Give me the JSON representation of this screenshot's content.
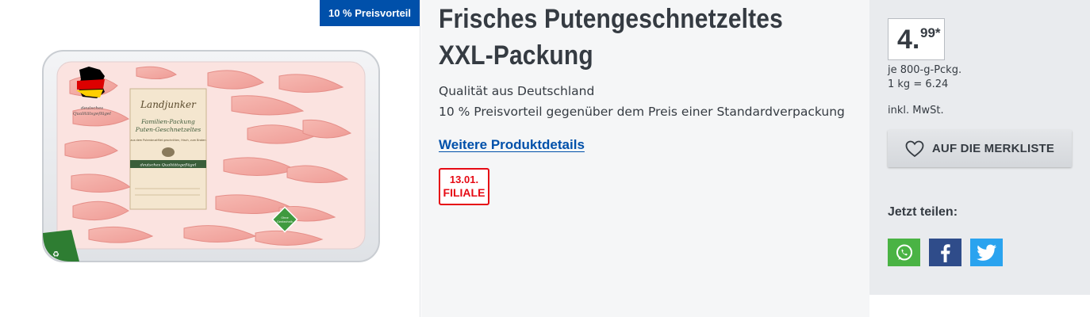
{
  "image_panel": {
    "promo_badge": "10 % Preisvorteil",
    "pack_brand": "Landjunker",
    "pack_line1": "Familien-Packung",
    "pack_line2": "Puten-Geschnetzeltes",
    "pack_small": "aus dem Putenbrustfilet geschnitten, frisch, zum Braten",
    "pack_band": "deutsches Qualitätsgeflügel",
    "flag_caption_1": "deutsches",
    "flag_caption_2": "Qualitätsgeflügel",
    "seal_text_1": "Ohne",
    "seal_text_2": "Gentechnik"
  },
  "product": {
    "title_line1": "Frisches Putengeschnetzeltes",
    "title_line2": "XXL-Packung",
    "desc_line1": "Qualität aus Deutschland",
    "desc_line2": "10 % Preisvorteil gegenüber dem Preis einer Standardverpackung",
    "details_link": "Weitere Produktdetails",
    "date_badge_date": "13.01.",
    "date_badge_label": "FILIALE"
  },
  "price": {
    "main": "4.",
    "cents": "99*",
    "unit_line1": "je 800-g-Pckg.",
    "unit_line2": "1 kg = 6.24",
    "tax": "inkl. MwSt.",
    "wishlist_label": "AUF DIE MERKLISTE",
    "share_label": "Jetzt teilen:"
  },
  "icons": {
    "wishlist": "heart-icon",
    "share": [
      "whatsapp-icon",
      "facebook-icon",
      "twitter-icon"
    ]
  },
  "colors": {
    "brand_blue": "#0050aa",
    "promo_red": "#e60a14",
    "whatsapp": "#4ab344",
    "facebook": "#2f4c8a",
    "twitter": "#2aa3ef"
  }
}
